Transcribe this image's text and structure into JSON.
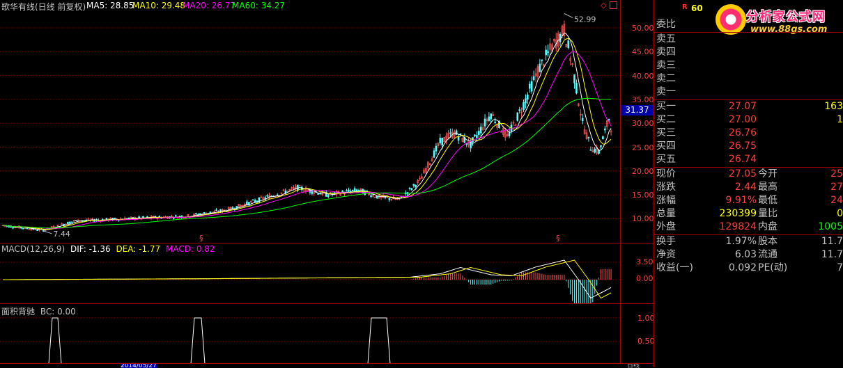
{
  "header": {
    "title": "歌华有线(日线 前复权)",
    "ma5": "MA5: 28.85",
    "ma10": "MA10: 29.48",
    "ma20": "MA20: 26.77",
    "ma60": "MA60: 34.27"
  },
  "price_chart": {
    "y_ticks": [
      "50.00",
      "45.00",
      "40.00",
      "35.00",
      "30.00",
      "25.00",
      "20.00",
      "15.00",
      "10.00"
    ],
    "high_label": "52.99",
    "low_label": "7.44",
    "current_price_label": "31.37",
    "colors": {
      "ma5": "#ffffff",
      "ma10": "#ffff00",
      "ma20": "#ff00ff",
      "ma60": "#00ff00",
      "up": "#ff5555",
      "down": "#54ffff"
    }
  },
  "macd_panel": {
    "params": "MACD(12,26,9)",
    "dif": "DIF: -1.36",
    "dea": "DEA: -1.77",
    "macd": "MACD: 0.82",
    "y_ticks": [
      "3.50",
      "0.00"
    ]
  },
  "bc_panel": {
    "title": "面积背驰",
    "bc": "BC: 0.00",
    "y_ticks": [
      "1.00",
      "0.50"
    ]
  },
  "bottom_axis": {
    "date_label": "2014/05/27",
    "right_label": "日线"
  },
  "quote_panel": {
    "code_prefix": "R",
    "code": "60",
    "watermark": {
      "brand": "分析家公式网",
      "url": "www.88gs.com"
    },
    "weibi_label": "委比",
    "sells": [
      {
        "label": "卖五"
      },
      {
        "label": "卖四"
      },
      {
        "label": "卖三"
      },
      {
        "label": "卖二"
      },
      {
        "label": "卖一"
      }
    ],
    "buys": [
      {
        "label": "买一",
        "price": "27.07",
        "vol": "163"
      },
      {
        "label": "买二",
        "price": "27.00",
        "vol": "1"
      },
      {
        "label": "买三",
        "price": "26.76",
        "vol": ""
      },
      {
        "label": "买四",
        "price": "26.75",
        "vol": ""
      },
      {
        "label": "买五",
        "price": "26.74",
        "vol": ""
      }
    ],
    "stats": [
      {
        "label": "现价",
        "value": "27.05",
        "label2": "今开",
        "value2": "25"
      },
      {
        "label": "涨跌",
        "value": "2.44",
        "label2": "最高",
        "value2": "27"
      },
      {
        "label": "涨幅",
        "value": "9.91%",
        "label2": "最低",
        "value2": "24"
      },
      {
        "label": "总量",
        "value": "230399",
        "label2": "量比",
        "value2": "0"
      },
      {
        "label": "外盘",
        "value": "129824",
        "label2": "内盘",
        "value2": "1005"
      }
    ],
    "fundamentals": [
      {
        "label": "换手",
        "value": "1.97%",
        "label2": "股本",
        "value2": "11.7"
      },
      {
        "label": "净资",
        "value": "6.03",
        "label2": "流通",
        "value2": "11.7"
      },
      {
        "label": "收益(一)",
        "value": "0.092",
        "label2": "PE(动)",
        "value2": "7"
      }
    ]
  }
}
